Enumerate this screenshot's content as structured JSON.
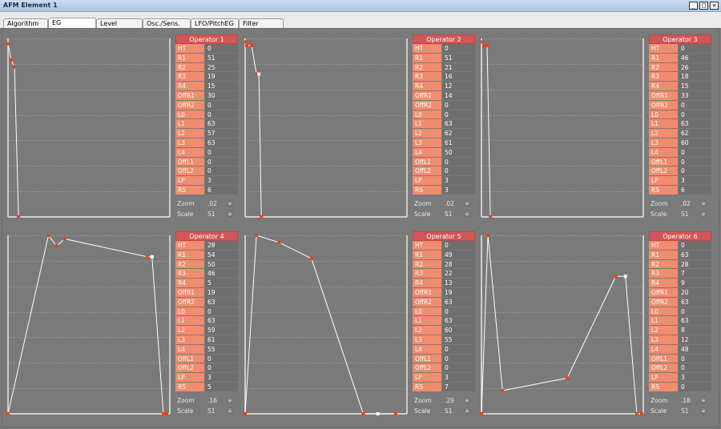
{
  "window": {
    "title": "AFM Element 1",
    "buttons": [
      "_",
      "□",
      "✕"
    ]
  },
  "tabs": [
    {
      "label": "Algorithm",
      "active": false
    },
    {
      "label": "EG",
      "active": true
    },
    {
      "label": "Level Scaling",
      "active": false
    },
    {
      "label": "Osc./Sens.",
      "active": false
    },
    {
      "label": "LFO/PitchEG",
      "active": false
    },
    {
      "label": "Filter",
      "active": false
    }
  ],
  "param_labels": [
    "HT",
    "R1",
    "R2",
    "R3",
    "R4",
    "OffR1",
    "OffR2",
    "L0",
    "L1",
    "L2",
    "L3",
    "L4",
    "OffL1",
    "OffL2",
    "LP",
    "RS"
  ],
  "control_labels": {
    "zoom": "Zoom",
    "scale": "Scale"
  },
  "operators": [
    {
      "name": "Operator 1",
      "values": [
        "0",
        "51",
        "25",
        "19",
        "15",
        "30",
        "0",
        "0",
        "63",
        "57",
        "63",
        "0",
        "0",
        "0",
        "3",
        "6"
      ],
      "zoom": ".02",
      "scale": "S1"
    },
    {
      "name": "Operator 2",
      "values": [
        "0",
        "51",
        "21",
        "16",
        "12",
        "14",
        "0",
        "0",
        "63",
        "62",
        "61",
        "50",
        "0",
        "0",
        "3",
        "3"
      ],
      "zoom": ".02",
      "scale": "S1"
    },
    {
      "name": "Operator 3",
      "values": [
        "0",
        "46",
        "26",
        "18",
        "15",
        "33",
        "0",
        "0",
        "63",
        "62",
        "60",
        "0",
        "0",
        "0",
        "3",
        "6"
      ],
      "zoom": ".02",
      "scale": "S1"
    },
    {
      "name": "Operator 4",
      "values": [
        "28",
        "54",
        "50",
        "46",
        "5",
        "19",
        "63",
        "0",
        "63",
        "59",
        "61",
        "55",
        "0",
        "0",
        "3",
        "5"
      ],
      "zoom": ".16",
      "scale": "S1"
    },
    {
      "name": "Operator 5",
      "values": [
        "0",
        "49",
        "28",
        "22",
        "13",
        "19",
        "63",
        "0",
        "63",
        "60",
        "55",
        "0",
        "0",
        "0",
        "3",
        "7"
      ],
      "zoom": ".29",
      "scale": "S1"
    },
    {
      "name": "Operator 6",
      "values": [
        "0",
        "63",
        "28",
        "7",
        "9",
        "20",
        "63",
        "0",
        "63",
        "8",
        "12",
        "48",
        "0",
        "0",
        "3",
        "0"
      ],
      "zoom": ".18",
      "scale": "S1"
    }
  ],
  "colors": {
    "envelope_line": "#ffffff",
    "point": "#e8401c",
    "point_selected": "#ffffff",
    "header": "#d15656",
    "label_bg": "#f18c6e"
  }
}
